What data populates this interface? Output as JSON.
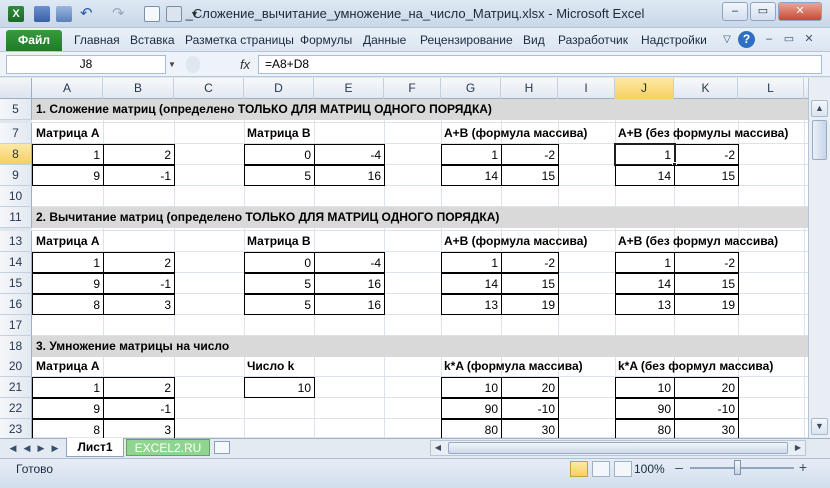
{
  "window": {
    "title": "_Сложение_вычитание_умножение_на_число_Матриц.xlsx  -  Microsoft Excel",
    "controls": {
      "minimize": "–",
      "restore": "▭",
      "close": "✕"
    }
  },
  "ribbon": {
    "file_tab": "Файл",
    "tabs": [
      "Главная",
      "Вставка",
      "Разметка страницы",
      "Формулы",
      "Данные",
      "Рецензирование",
      "Вид",
      "Разработчик",
      "Надстройки"
    ]
  },
  "formula_bar": {
    "name_box": "J8",
    "fx": "fx",
    "formula": "=A8+D8"
  },
  "columns": [
    "A",
    "B",
    "C",
    "D",
    "E",
    "F",
    "G",
    "H",
    "I",
    "J",
    "K",
    "L"
  ],
  "selected_column": "J",
  "rows": [
    "5",
    "7",
    "8",
    "9",
    "10",
    "11",
    "13",
    "14",
    "15",
    "16",
    "17",
    "18",
    "20",
    "21",
    "22",
    "23"
  ],
  "selected_row": "8",
  "sections": {
    "s1": "1. Сложение матриц (определено ТОЛЬКО ДЛЯ МАТРИЦ ОДНОГО ПОРЯДКА)",
    "s2": "2. Вычитание матриц  (определено ТОЛЬКО ДЛЯ МАТРИЦ ОДНОГО ПОРЯДКА)",
    "s3": "3. Умножение матрицы на число"
  },
  "headers": {
    "a1": "Матрица А",
    "b1": "Матрица В",
    "c1": "А+В (формула массива)",
    "d1": "А+В (без формулы массива)",
    "a2": "Матрица А",
    "b2": "Матрица В",
    "c2": "А+В (формула массива)",
    "d2": "А+В (без формул массива)",
    "a3": "Матрица А",
    "k3": "Число k",
    "c3": "k*A (формула массива)",
    "d3": "k*A (без формул массива)"
  },
  "cells": {
    "r8": [
      "1",
      "2",
      "0",
      "-4",
      "1",
      "-2",
      "1",
      "-2"
    ],
    "r9": [
      "9",
      "-1",
      "5",
      "16",
      "14",
      "15",
      "14",
      "15"
    ],
    "r14": [
      "1",
      "2",
      "0",
      "-4",
      "1",
      "-2",
      "1",
      "-2"
    ],
    "r15": [
      "9",
      "-1",
      "5",
      "16",
      "14",
      "15",
      "14",
      "15"
    ],
    "r16": [
      "8",
      "3",
      "5",
      "16",
      "13",
      "19",
      "13",
      "19"
    ],
    "r21": [
      "1",
      "2",
      "10",
      "10",
      "20",
      "10",
      "20"
    ],
    "r22": [
      "9",
      "-1",
      "90",
      "-10",
      "90",
      "-10"
    ],
    "r23": [
      "8",
      "3",
      "80",
      "30",
      "80",
      "30"
    ]
  },
  "sheet_tabs": [
    "Лист1",
    "EXCEL2.RU"
  ],
  "status": {
    "ready": "Готово",
    "zoom": "100%",
    "zoom_minus": "–",
    "zoom_plus": "+"
  }
}
